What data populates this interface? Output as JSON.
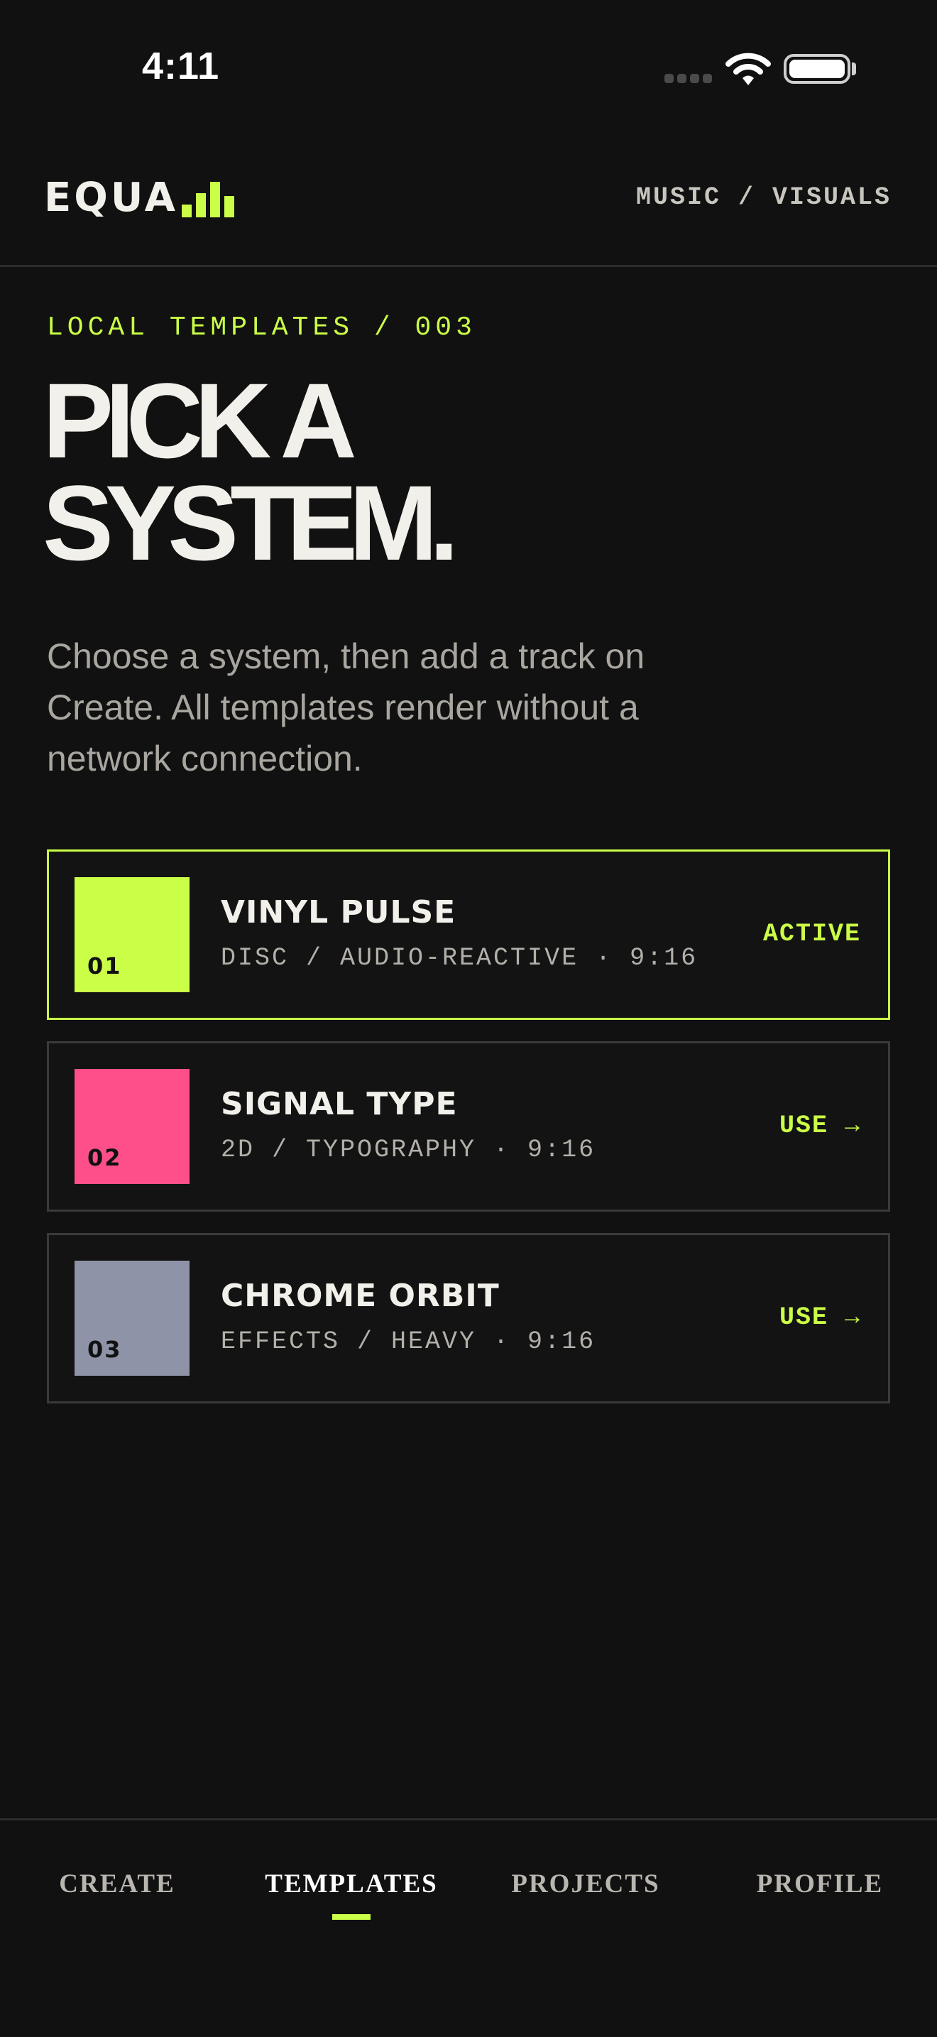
{
  "status": {
    "time": "4:11"
  },
  "header": {
    "logo": "EQUA",
    "nav": "MUSIC / VISUALS"
  },
  "main": {
    "eyebrow": "LOCAL TEMPLATES / 003",
    "headline_line1": "PICK A",
    "headline_line2": "SYSTEM.",
    "description": "Choose a system, then add a track on Create. All templates render without a network connection."
  },
  "templates": [
    {
      "num": "01",
      "title": "VINYL PULSE",
      "meta": "DISC / AUDIO-REACTIVE · 9:16",
      "action": "ACTIVE",
      "color": "#cbff47",
      "active": true
    },
    {
      "num": "02",
      "title": "SIGNAL TYPE",
      "meta": "2D / TYPOGRAPHY · 9:16",
      "action": "USE →",
      "color": "#ff4f8b",
      "active": false
    },
    {
      "num": "03",
      "title": "CHROME ORBIT",
      "meta": "EFFECTS / HEAVY · 9:16",
      "action": "USE →",
      "color": "#8e93a8",
      "active": false
    }
  ],
  "bottom_nav": [
    {
      "label": "CREATE",
      "active": false
    },
    {
      "label": "TEMPLATES",
      "active": true
    },
    {
      "label": "PROJECTS",
      "active": false
    },
    {
      "label": "PROFILE",
      "active": false
    }
  ],
  "accent_color": "#cbff47"
}
